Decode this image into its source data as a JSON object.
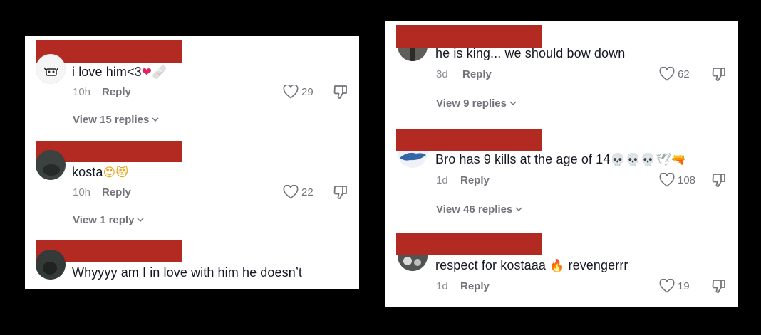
{
  "left_panel": {
    "comments": [
      {
        "text": "i love him<3",
        "emoji": [
          "❤",
          "🩹"
        ],
        "time": "10h",
        "reply": "Reply",
        "likes": "29",
        "view_replies": "View 15 replies"
      },
      {
        "text": "kosta",
        "emoji": [
          "😍",
          "😻"
        ],
        "time": "10h",
        "reply": "Reply",
        "likes": "22",
        "view_replies": "View 1 reply"
      },
      {
        "text": "Whyyyy am I in love with him he doesn’t"
      }
    ]
  },
  "right_panel": {
    "comments": [
      {
        "text": "he is king... we should bow down",
        "time": "3d",
        "reply": "Reply",
        "likes": "62",
        "view_replies": "View 9 replies"
      },
      {
        "text": "Bro has 9 kills at the age of 14",
        "emoji": [
          "💀",
          "💀",
          "💀",
          "🕊",
          "🔫"
        ],
        "time": "1d",
        "reply": "Reply",
        "likes": "108",
        "view_replies": "View 46 replies"
      },
      {
        "text": "respect for kostaaa",
        "emoji_mid": "🔥",
        "text_after": "revengerrr",
        "time": "1d",
        "reply": "Reply",
        "likes": "19"
      }
    ]
  },
  "colors": {
    "redaction": "#b22a22",
    "text": "#161823",
    "muted": "#8a8b91",
    "background": "#000000"
  },
  "icons": [
    "heart-outline-icon",
    "thumbs-down-outline-icon",
    "chevron-down-icon"
  ]
}
